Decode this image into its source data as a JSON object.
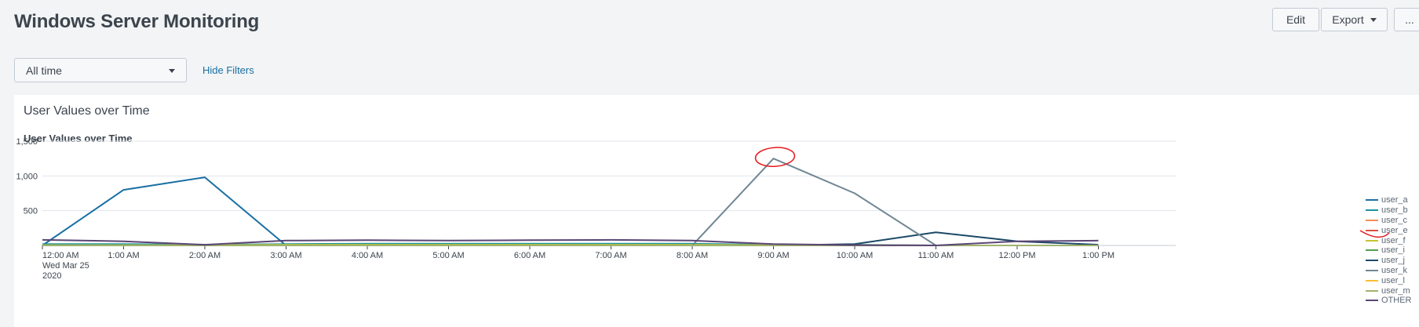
{
  "header": {
    "title": "Windows Server Monitoring",
    "edit_label": "Edit",
    "export_label": "Export",
    "more_label": "..."
  },
  "filters": {
    "time_range": "All time",
    "hide_filters_label": "Hide Filters"
  },
  "panel": {
    "title": "User Values over Time"
  },
  "chart_data": {
    "type": "line",
    "title": "User Values over Time",
    "xlabel": "",
    "ylabel": "",
    "ylim": [
      0,
      1500
    ],
    "y_ticks": [
      "1,500",
      "1,000",
      "500"
    ],
    "x_ticks": [
      "12:00 AM",
      "1:00 AM",
      "2:00 AM",
      "3:00 AM",
      "4:00 AM",
      "5:00 AM",
      "6:00 AM",
      "7:00 AM",
      "8:00 AM",
      "9:00 AM",
      "10:00 AM",
      "11:00 AM",
      "12:00 PM",
      "1:00 PM"
    ],
    "x_date_label": "Wed Mar 25",
    "x_year_label": "2020",
    "x": [
      "12:00 AM",
      "1:00 AM",
      "2:00 AM",
      "3:00 AM",
      "4:00 AM",
      "5:00 AM",
      "6:00 AM",
      "7:00 AM",
      "8:00 AM",
      "9:00 AM",
      "10:00 AM",
      "11:00 AM",
      "12:00 PM",
      "1:00 PM"
    ],
    "series": [
      {
        "name": "user_a",
        "color": "#1a6fa3",
        "values": [
          0,
          800,
          980,
          0,
          0,
          0,
          0,
          0,
          0,
          0,
          0,
          0,
          0,
          0
        ]
      },
      {
        "name": "user_b",
        "color": "#1e93a0",
        "values": [
          20,
          20,
          10,
          20,
          25,
          25,
          25,
          25,
          25,
          10,
          10,
          0,
          0,
          0
        ]
      },
      {
        "name": "user_c",
        "color": "#f58f55",
        "values": [
          0,
          0,
          0,
          0,
          0,
          0,
          0,
          0,
          0,
          0,
          0,
          0,
          0,
          0
        ]
      },
      {
        "name": "user_e",
        "color": "#dc4e41",
        "values": [
          0,
          0,
          0,
          0,
          0,
          0,
          0,
          0,
          0,
          0,
          0,
          0,
          0,
          0
        ]
      },
      {
        "name": "user_f",
        "color": "#c5c432",
        "values": [
          5,
          5,
          5,
          10,
          10,
          10,
          10,
          10,
          10,
          5,
          5,
          0,
          0,
          0
        ]
      },
      {
        "name": "user_i",
        "color": "#53a051",
        "values": [
          0,
          0,
          0,
          0,
          0,
          0,
          0,
          0,
          0,
          0,
          0,
          0,
          0,
          0
        ]
      },
      {
        "name": "user_j",
        "color": "#1c4966",
        "values": [
          0,
          0,
          0,
          0,
          0,
          0,
          0,
          0,
          0,
          0,
          20,
          190,
          60,
          10
        ]
      },
      {
        "name": "user_k",
        "color": "#708794",
        "values": [
          0,
          0,
          0,
          0,
          0,
          0,
          0,
          0,
          0,
          1250,
          750,
          0,
          0,
          0
        ]
      },
      {
        "name": "user_l",
        "color": "#f8be34",
        "values": [
          0,
          0,
          0,
          0,
          0,
          0,
          0,
          0,
          0,
          0,
          0,
          0,
          0,
          0
        ]
      },
      {
        "name": "user_m",
        "color": "#a2b36d",
        "values": [
          0,
          0,
          0,
          0,
          0,
          0,
          0,
          0,
          0,
          0,
          0,
          0,
          0,
          0
        ]
      },
      {
        "name": "OTHER",
        "color": "#5a4575",
        "values": [
          80,
          60,
          10,
          70,
          75,
          70,
          75,
          80,
          70,
          20,
          5,
          0,
          60,
          70
        ]
      }
    ],
    "grid": true,
    "legend_position": "right"
  }
}
